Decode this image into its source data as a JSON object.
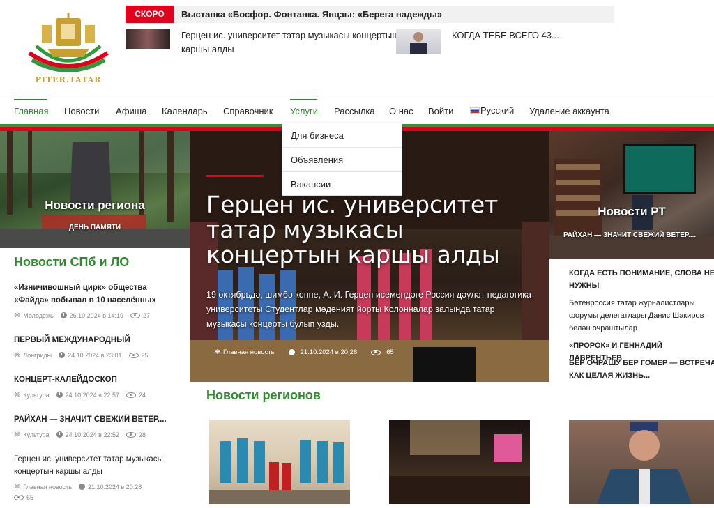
{
  "logo": {
    "text": "PITER.TATAR"
  },
  "soon": {
    "badge": "СКОРО",
    "text": "Выставка «Босфор. Фонтанка. Янцзы: «Берега надежды»"
  },
  "top_news": [
    {
      "line1": "Герцен ис. университет татар музыкасы концертын",
      "line2": "каршы алды"
    },
    {
      "text": "КОГДА ТЕБЕ ВСЕГО 43..."
    }
  ],
  "nav": {
    "items": [
      "Главная",
      "Новости",
      "Афиша",
      "Календарь",
      "Справочник",
      "Услуги",
      "Рассылка",
      "О нас",
      "Войти",
      "Русский",
      "Удаление аккаунта"
    ],
    "active": "Главная",
    "open": "Услуги"
  },
  "dropdown": [
    "Для бизнеса",
    "Объявления",
    "Вакансии"
  ],
  "left_tile": {
    "title": "Новости региона",
    "subtitle": "ДЕНЬ ПАМЯТИ"
  },
  "hero": {
    "title": "Герцен ис. университет татар музыкасы концертын каршы алды",
    "lead": "19 октябрьдә, шимбә көнне, А. И. Герцен исемендәге Россия дәүләт педагогика университеты Студентлар мәдәният йорты Колонналар залында татар музыкасы концерты булып узды.",
    "category": "Главная новость",
    "date": "21.10.2024 в 20:28",
    "views": "65"
  },
  "right_tile": {
    "title": "Новости РТ",
    "subtitle": "РАЙХАН — ЗНАЧИТ СВЕЖИЙ ВЕТЕР...."
  },
  "left_section": {
    "title": "Новости СПб и ЛО",
    "items": [
      {
        "title": "«Изничивошный цирк» общества «Файда» побывал в 10 населённых",
        "category": "Молодежь",
        "date": "26.10.2024 в 14:19",
        "views": "27"
      },
      {
        "title": "ПЕРВЫЙ МЕЖДУНАРОДНЫЙ",
        "category": "Лонгриды",
        "date": "24.10.2024 в 23:01",
        "views": "25"
      },
      {
        "title": "КОНЦЕРТ-КАЛЕЙДОСКОП",
        "category": "Культура",
        "date": "24.10.2024 в 22:57",
        "views": "24"
      },
      {
        "title": "РАЙХАН — ЗНАЧИТ СВЕЖИЙ ВЕТЕР....",
        "category": "Культура",
        "date": "24.10.2024 в 22:52",
        "views": "28"
      },
      {
        "title": "Герцен ис. университет татар музыкасы концертын каршы алды",
        "category": "Главная новость",
        "date": "21.10.2024 в 20:28",
        "views": "65"
      }
    ]
  },
  "right_section": {
    "items": [
      "КОГДА ЕСТЬ ПОНИМАНИЕ, СЛОВА НЕ НУЖНЫ",
      "Бөтенроссия татар журналистлары форумы делегатлары Данис Шакиров белән очраштылар",
      "«ПРОРОК» И ГЕННАДИЙ ЛАВРЕНТЬЕВ",
      "БЕР ОЧРАШУ БЕР ГОМЕР — ВСТРЕЧА КАК ЦЕЛАЯ ЖИЗНЬ..."
    ]
  },
  "regions_section": {
    "title": "Новости регионов"
  },
  "colors": {
    "green": "#2e8b2e",
    "red": "#e2001a",
    "gold": "#c8a032"
  }
}
